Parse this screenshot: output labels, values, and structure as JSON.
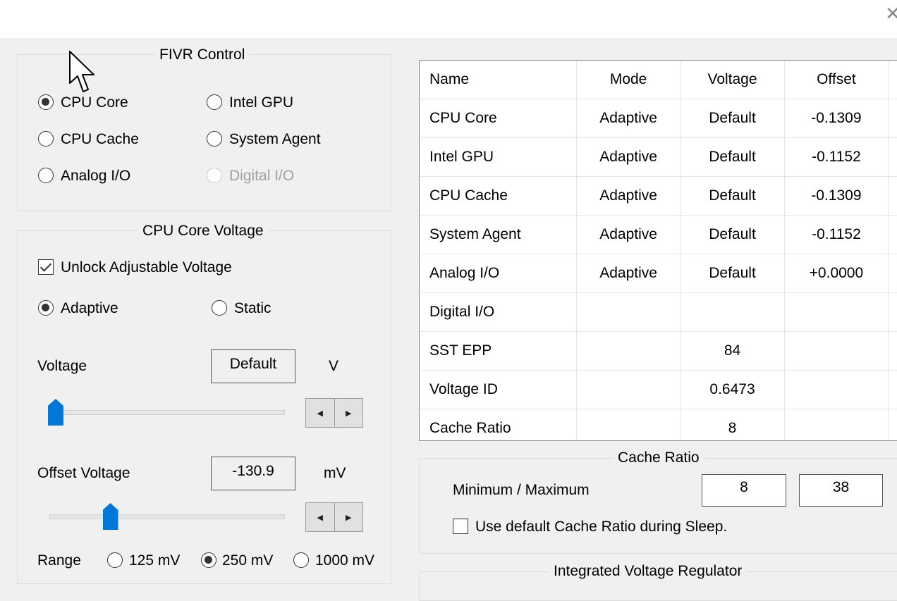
{
  "window": {
    "close_glyph": "✕"
  },
  "fivr": {
    "title": "FIVR Control",
    "options": [
      {
        "label": "CPU Core",
        "selected": true,
        "disabled": false
      },
      {
        "label": "Intel GPU",
        "selected": false,
        "disabled": false
      },
      {
        "label": "CPU Cache",
        "selected": false,
        "disabled": false
      },
      {
        "label": "System Agent",
        "selected": false,
        "disabled": false
      },
      {
        "label": "Analog I/O",
        "selected": false,
        "disabled": false
      },
      {
        "label": "Digital I/O",
        "selected": false,
        "disabled": true
      }
    ]
  },
  "core_voltage": {
    "title": "CPU Core Voltage",
    "unlock_label": "Unlock Adjustable Voltage",
    "unlock_checked": true,
    "mode_options": [
      {
        "label": "Adaptive",
        "selected": true
      },
      {
        "label": "Static",
        "selected": false
      }
    ],
    "voltage_label": "Voltage",
    "voltage_value": "Default",
    "voltage_unit": "V",
    "voltage_slider_level": 0.0,
    "offset_label": "Offset Voltage",
    "offset_value": "-130.9",
    "offset_unit": "mV",
    "offset_slider_level": 0.25,
    "range_label": "Range",
    "range_options": [
      {
        "label": "125 mV",
        "selected": false
      },
      {
        "label": "250 mV",
        "selected": true
      },
      {
        "label": "1000 mV",
        "selected": false
      }
    ],
    "spin_left": "◀",
    "spin_right": "▶"
  },
  "table": {
    "headers": [
      "Name",
      "Mode",
      "Voltage",
      "Offset"
    ],
    "rows": [
      [
        "CPU Core",
        "Adaptive",
        "Default",
        "-0.1309"
      ],
      [
        "Intel GPU",
        "Adaptive",
        "Default",
        "-0.1152"
      ],
      [
        "CPU Cache",
        "Adaptive",
        "Default",
        "-0.1309"
      ],
      [
        "System Agent",
        "Adaptive",
        "Default",
        "-0.1152"
      ],
      [
        "Analog I/O",
        "Adaptive",
        "Default",
        "+0.0000"
      ],
      [
        "Digital I/O",
        "",
        "",
        ""
      ],
      [
        "SST EPP",
        "",
        "84",
        ""
      ],
      [
        "Voltage ID",
        "",
        "0.6473",
        ""
      ],
      [
        "Cache Ratio",
        "",
        "8",
        ""
      ]
    ]
  },
  "cache_ratio": {
    "title": "Cache Ratio",
    "minmax_label": "Minimum / Maximum",
    "min_value": "8",
    "max_value": "38",
    "sleep_label": "Use default Cache Ratio during Sleep.",
    "sleep_checked": false
  },
  "ivr": {
    "title": "Integrated Voltage Regulator"
  },
  "colors": {
    "accent": "#0078d7",
    "background": "#f0f0f0"
  }
}
